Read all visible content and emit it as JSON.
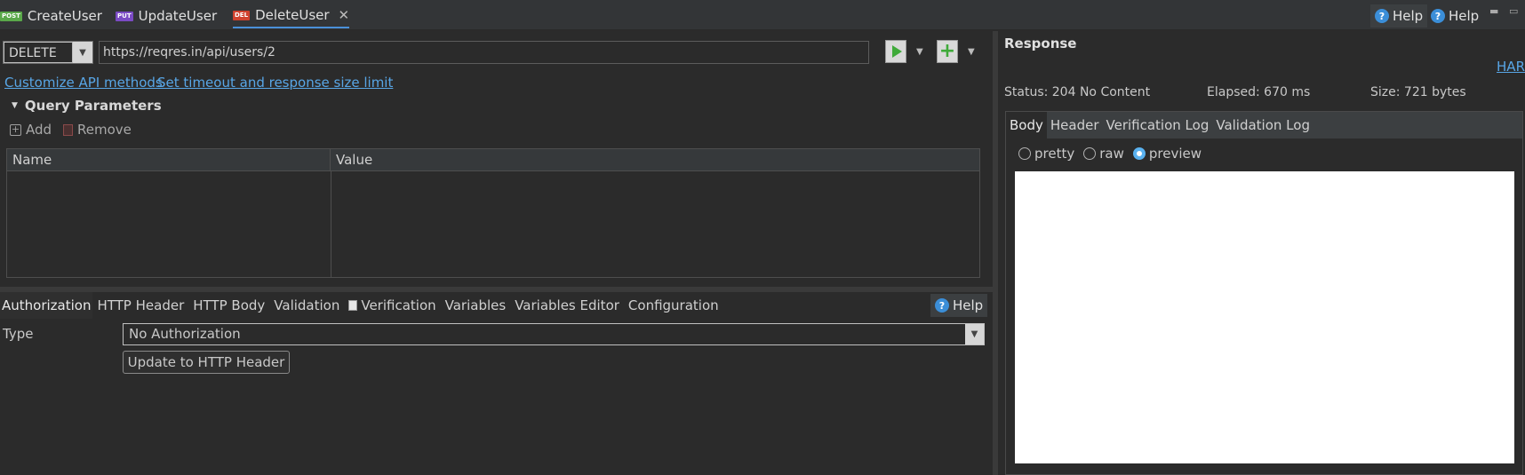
{
  "tabs": [
    {
      "badge": "POST",
      "badge_color": "#5aa84a",
      "label": "CreateUser"
    },
    {
      "badge": "PUT",
      "badge_color": "#7b4bc4",
      "label": "UpdateUser"
    },
    {
      "badge": "DEL",
      "badge_color": "#d0422e",
      "label": "DeleteUser",
      "active": true
    }
  ],
  "top_right": {
    "help1": "Help",
    "help2": "Help"
  },
  "request": {
    "method": "DELETE",
    "url": "https://reqres.in/api/users/2",
    "customize_link": "Customize API methods",
    "timeout_link": "Set timeout and response size limit"
  },
  "query": {
    "title": "Query Parameters",
    "add_label": "Add",
    "remove_label": "Remove",
    "columns": [
      "Name",
      "Value"
    ]
  },
  "subtabs": {
    "authorization": "Authorization",
    "http_header": "HTTP Header",
    "http_body": "HTTP Body",
    "validation": "Validation",
    "verification": "Verification",
    "variables": "Variables",
    "variables_editor": "Variables Editor",
    "configuration": "Configuration",
    "help": "Help"
  },
  "auth": {
    "type_label": "Type",
    "type_value": "No Authorization",
    "update_button": "Update to HTTP Header"
  },
  "response": {
    "title": "Response",
    "har": "HAR",
    "status": "Status: 204 No Content",
    "elapsed": "Elapsed: 670 ms",
    "size": "Size: 721 bytes",
    "tabs": {
      "body": "Body",
      "header": "Header",
      "verification_log": "Verification Log",
      "validation_log": "Validation Log"
    },
    "modes": {
      "pretty": "pretty",
      "raw": "raw",
      "preview": "preview",
      "selected": "preview"
    }
  },
  "colors": {
    "accent": "#4a90d9",
    "link": "#58a6e6",
    "run": "#3faa3a"
  }
}
